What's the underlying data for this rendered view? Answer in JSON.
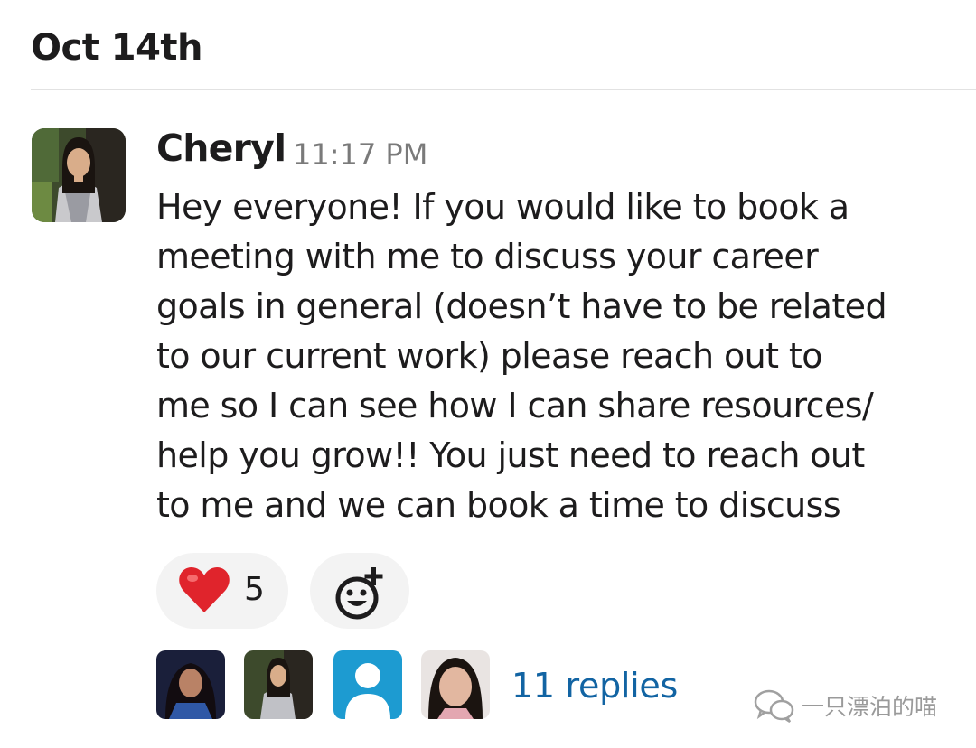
{
  "date_header": "Oct 14th",
  "message": {
    "author": "Cheryl",
    "timestamp": "11:17 PM",
    "lines": [
      "Hey everyone! If you would like to book a",
      "meeting with me to discuss your career",
      "goals in general (doesn’t have to be related",
      "to our current work) please reach out to",
      "me so I can see how I can share resources/",
      "help you grow!! You just need to reach out",
      "to me and we can book a time to discuss"
    ]
  },
  "reactions": [
    {
      "icon": "red-heart-icon",
      "count": "5"
    }
  ],
  "add_reaction_icon": "add-reaction-icon",
  "thread": {
    "participants": [
      "avatar-woman-dark-hair",
      "avatar-cheryl",
      "avatar-default-user",
      "avatar-woman-selfie"
    ],
    "replies_label": "11 replies"
  },
  "watermark": {
    "icon": "wechat-icon",
    "text": "一只漂泊的喵"
  },
  "colors": {
    "link": "#1264a3",
    "reaction_bg": "#f3f3f3",
    "heart": "#e0242c",
    "default_avatar": "#1d9bd1",
    "timestamp": "#7a7a7a"
  }
}
